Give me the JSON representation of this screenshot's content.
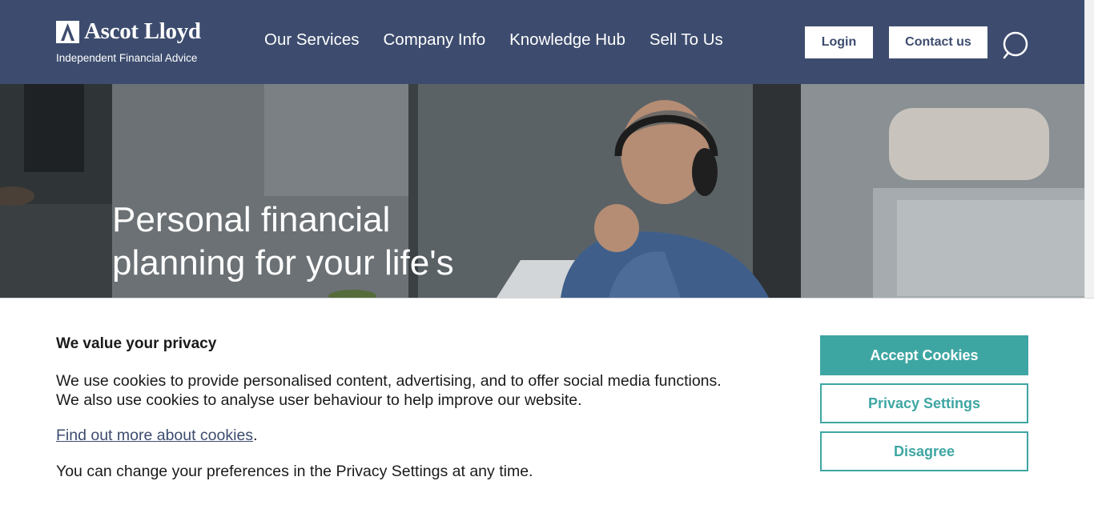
{
  "brand": {
    "name": "Ascot Lloyd",
    "tagline": "Independent Financial Advice"
  },
  "nav": {
    "items": [
      "Our Services",
      "Company Info",
      "Knowledge Hub",
      "Sell To Us"
    ]
  },
  "header_actions": {
    "login_label": "Login",
    "contact_label": "Contact us",
    "search_icon": "search-icon"
  },
  "hero": {
    "title": "Personal financial planning for your life's"
  },
  "cookie_banner": {
    "heading": "We value your privacy",
    "body_line1": "We use cookies to provide personalised content, advertising, and to offer social media functions.",
    "body_line2": "We also use cookies to analyse user behaviour to help improve our website.",
    "link_text": "Find out more about cookies",
    "link_suffix": ".",
    "note": "You can change your preferences in the Privacy Settings at any time.",
    "accept_label": "Accept Cookies",
    "privacy_label": "Privacy Settings",
    "disagree_label": "Disagree"
  },
  "colors": {
    "header_bg": "#3d4c6e",
    "accent_teal": "#3ea6a2",
    "text_dark": "#1a1a1a"
  }
}
